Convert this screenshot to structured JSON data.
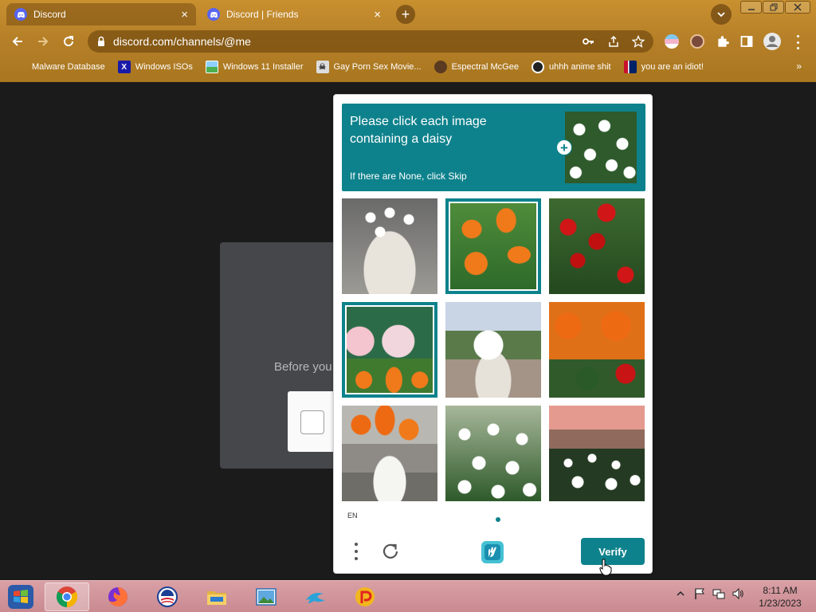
{
  "browser": {
    "tabs": [
      {
        "title": "Discord",
        "active": true
      },
      {
        "title": "Discord | Friends",
        "active": false
      }
    ],
    "url": "discord.com/channels/@me",
    "bookmarks": [
      {
        "label": "Malware Database",
        "icon": "malware-icon"
      },
      {
        "label": "Windows ISOs",
        "icon": "x-icon"
      },
      {
        "label": "Windows 11 Installer",
        "icon": "image-icon"
      },
      {
        "label": "Gay Porn Sex Movie...",
        "icon": "skull-icon"
      },
      {
        "label": "Espectral McGee",
        "icon": "face-icon"
      },
      {
        "label": "uhhh anime shit",
        "icon": "anime-icon"
      },
      {
        "label": "you are an idiot!",
        "icon": "flag-icon"
      }
    ],
    "bookmarks_more": "»"
  },
  "page": {
    "background_text": "Before you"
  },
  "captcha": {
    "prompt_line": "Please click each image containing a daisy",
    "prompt_hint": "If there are None, click Skip",
    "language": "EN",
    "verify_label": "Verify",
    "accent_color": "#0e828c",
    "tiles": [
      {
        "subject": "daisies in white pot",
        "selected": false
      },
      {
        "subject": "orange tulips",
        "selected": true
      },
      {
        "subject": "red roses",
        "selected": false
      },
      {
        "subject": "pink roses and orange tulips",
        "selected": true
      },
      {
        "subject": "daisies with white pot",
        "selected": false
      },
      {
        "subject": "orange tulips and red roses",
        "selected": false
      },
      {
        "subject": "orange tulips in white vase",
        "selected": false
      },
      {
        "subject": "field of daisies",
        "selected": false
      },
      {
        "subject": "daisy field at sunset",
        "selected": false
      }
    ]
  },
  "taskbar": {
    "time": "8:11 AM",
    "date": "1/23/2023",
    "apps": [
      "chrome",
      "firefox",
      "obama",
      "explorer",
      "photos",
      "dolphin",
      "picsart"
    ]
  }
}
